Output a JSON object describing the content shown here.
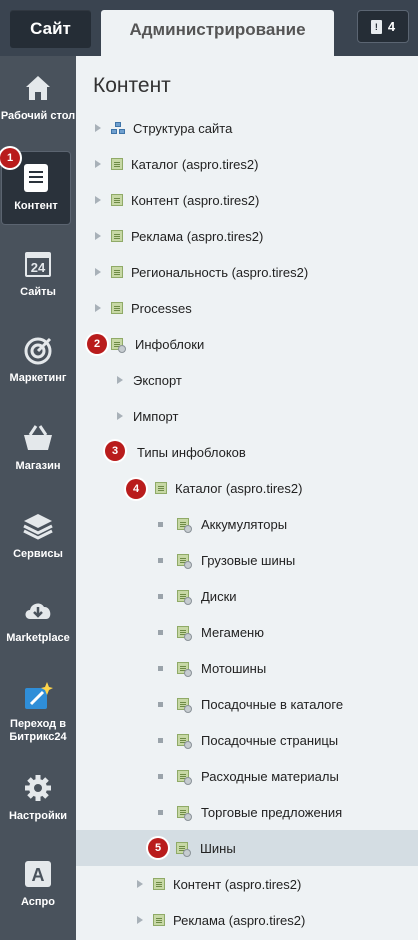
{
  "topbar": {
    "site": "Сайт",
    "admin": "Администрирование",
    "notif_count": "4"
  },
  "sidebar": {
    "items": [
      {
        "label": "Рабочий стол",
        "icon": "home-icon"
      },
      {
        "label": "Контент",
        "icon": "document-icon"
      },
      {
        "label": "Сайты",
        "icon": "calendar-24-icon"
      },
      {
        "label": "Маркетинг",
        "icon": "target-icon"
      },
      {
        "label": "Магазин",
        "icon": "basket-icon"
      },
      {
        "label": "Сервисы",
        "icon": "layers-icon"
      },
      {
        "label": "Marketplace",
        "icon": "cloud-download-icon"
      },
      {
        "label": "Переход в Битрикс24",
        "icon": "magic-wand-icon"
      },
      {
        "label": "Настройки",
        "icon": "gear-icon"
      },
      {
        "label": "Аспро",
        "icon": "aspro-a-icon"
      }
    ]
  },
  "main": {
    "title": "Контент",
    "tree": [
      "Структура сайта",
      "Каталог (aspro.tires2)",
      "Контент (aspro.tires2)",
      "Реклама (aspro.tires2)",
      "Региональность (aspro.tires2)",
      "Processes",
      "Инфоблоки",
      "Экспорт",
      "Импорт",
      "Типы инфоблоков",
      "Каталог (aspro.tires2)",
      "Аккумуляторы",
      "Грузовые шины",
      "Диски",
      "Мегаменю",
      "Мотошины",
      "Посадочные в каталоге",
      "Посадочные страницы",
      "Расходные материалы",
      "Торговые предложения",
      "Шины",
      "Контент (aspro.tires2)",
      "Реклама (aspro.tires2)"
    ]
  },
  "badges": [
    "1",
    "2",
    "3",
    "4",
    "5"
  ],
  "colors": {
    "badge": "#b91c1c",
    "sidebar": "#49525c",
    "topbar": "#3a4450",
    "selected_row": "#d4dde3"
  }
}
